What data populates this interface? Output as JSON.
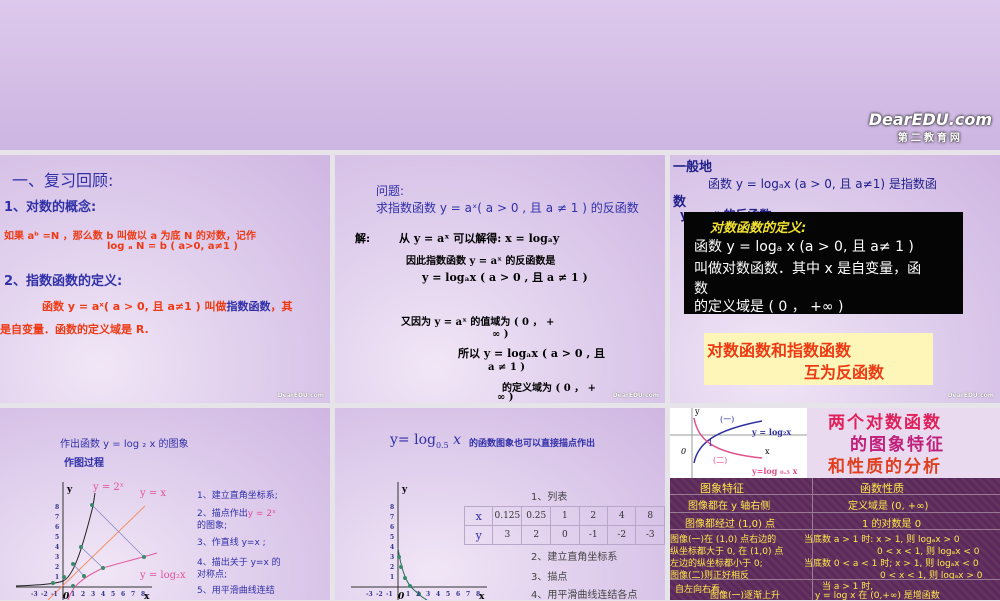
{
  "banner": {
    "logo": "DearEDU.com",
    "logo_sub": "第二教育网"
  },
  "watermark": "DearEDU.com",
  "p1": {
    "title": "一、复习回顾:",
    "h1": "1、对数的概念:",
    "l1": "如果 aᵇ =N ，那么数 b 叫做以 a 为底 N 的对数，记作",
    "l2": "log ₐ N = b ( a>0, a≠1 )",
    "h2": "2、指数函数的定义:",
    "l3a": "函数  y = aˣ( a  >  0, 且  a≠1 ) 叫做",
    "l3b": "指数函数",
    "l3c": "，其",
    "l4": "是自变量．函数的定义域是  R."
  },
  "p2": {
    "q": "问题:",
    "q2": "求指数函数  y  =   aˣ( a > 0 , 且  a ≠ 1 ) 的反函数",
    "s0": "解:",
    "s1": "从  y  =   aˣ 可以解得:  x  =   logₐy",
    "s2": "因此指数函数  y  =   aˣ 的反函数是",
    "s3": "y = logₐx ( a > 0 , 且  a ≠ 1 )",
    "s4": "又因为  y  =   aˣ 的值域为 ( 0 ，  +",
    "s5": "∞ )",
    "s6": "所以  y = logₐx ( a > 0 , 且",
    "s7": "a ≠ 1 )",
    "s8": "的定义域为 ( 0 ，  +",
    "s9": "∞ )"
  },
  "p3": {
    "t1": "一般地",
    "t2": "函数  y = logₐx  (a > 0, 且 a≠1) 是指数函",
    "t3": "数",
    "t4": "y = aˣ 的反函数",
    "def_title": "对数函数的定义:",
    "d1": "函数  y = logₐ x  (a > 0, 且 a≠ 1 )",
    "d2": "叫做对数函数．其中  x 是自变量，函",
    "d3": "数",
    "d4": "的定义域是 (  0 ，  +∞ )",
    "c1": "对数函数和指数函数",
    "c2": "互为反函数"
  },
  "p4": {
    "title": "作出函数  y  =   log ₂ x 的图象",
    "sub": "作图过程",
    "lbl_exp": "y =  2ˣ",
    "lbl_id": "y = x",
    "lbl_log": "y = log₂x",
    "axis_y": "y",
    "axis_x": "x",
    "origin": "0",
    "steps": [
      "1、建立直角坐标系;",
      "2、描点作出",
      "y =  2ˣ",
      "的图象;",
      "3、作直线 y=x ;",
      "4、描出关于 y=x 的",
      "对称点;",
      "5、用平滑曲线连结"
    ],
    "xticks": [
      "-3",
      "-2",
      "-1",
      "1",
      "2",
      "3",
      "4",
      "5",
      "6",
      "7",
      "8"
    ],
    "yticks": [
      "1",
      "2",
      "3",
      "4",
      "5",
      "6",
      "7",
      "8"
    ]
  },
  "p5": {
    "title_a": "y=  log",
    "title_b": "0.5",
    "title_c": " x",
    "title_d": "的函数图象也可以直接描点作出",
    "steps": [
      "1、列表",
      "2、建立直角坐标系",
      "3、描点",
      "4、用平滑曲线连结各点"
    ],
    "table": {
      "x_label": "x",
      "y_label": "y",
      "x": [
        "0.125",
        "0.25",
        "1",
        "2",
        "4",
        "8"
      ],
      "y": [
        "3",
        "2",
        "0",
        "-1",
        "-2",
        "-3"
      ]
    },
    "axis_y": "y",
    "axis_x": "x",
    "origin": "0",
    "xticks": [
      "-3",
      "-2",
      "-1",
      "1",
      "2",
      "3",
      "4",
      "5",
      "6",
      "7",
      "8"
    ],
    "yticks": [
      "1",
      "2",
      "3",
      "4",
      "5",
      "6",
      "7",
      "8"
    ]
  },
  "p6": {
    "g1": "(一)",
    "g2": "(二)",
    "lbl1": "y = log₂x",
    "lbl2": "y=log ₀.₅ x",
    "one": "1",
    "zero": "0",
    "xl": "x",
    "yl": "y",
    "title": [
      "两个对数函数",
      "的图象特征",
      "和性质的分析"
    ],
    "head": [
      "图象特征",
      "函数性质"
    ],
    "rows": [
      [
        "图像都在 y 轴右侧",
        "定义域是 (0, +∞)"
      ],
      [
        "图像都经过 (1,0) 点",
        "1 的对数是 0"
      ]
    ],
    "left3": [
      "图像(一)在 (1,0) 点右边的",
      "纵坐标都大于 0, 在 (1,0) 点",
      "左边的纵坐标都小于 0;",
      "图像(二)则正好相反"
    ],
    "right3": [
      "当底数 a > 1 时: x > 1, 则 logₐx > 0",
      "0 < x < 1, 则 logₐx < 0",
      "当底数 0 < a < 1 时; x > 1, 则 logₐx < 0",
      "0 < x < 1, 则 logₐx > 0"
    ],
    "left4": [
      "自左向右看,",
      "图像(一)逐渐上升"
    ],
    "right4": [
      "当 a > 1 时,",
      "y = log x 在 (0,+∞) 是增函数"
    ]
  }
}
